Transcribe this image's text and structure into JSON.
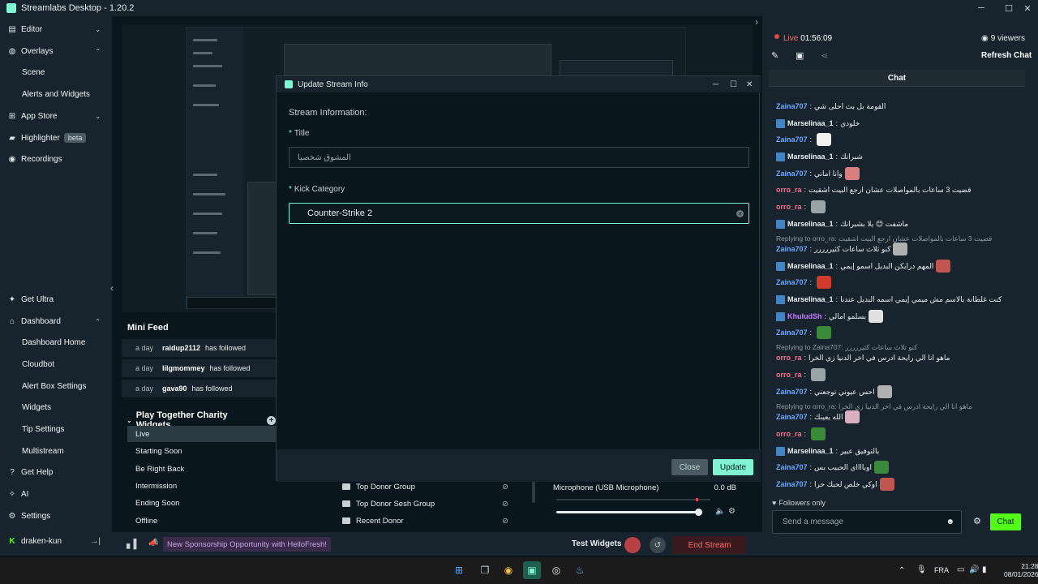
{
  "window": {
    "title": "Streamlabs Desktop - 1.20.2",
    "controls": {
      "minimize": "─",
      "maximize": "☐",
      "close": "✕"
    }
  },
  "sidebar": {
    "items": [
      {
        "label": "Editor"
      },
      {
        "label": "Overlays"
      },
      {
        "label": "Scene"
      },
      {
        "label": "Alerts and Widgets"
      },
      {
        "label": "App Store"
      },
      {
        "label": "Highlighter",
        "badge": "beta"
      },
      {
        "label": "Recordings"
      },
      {
        "label": "Get Ultra"
      },
      {
        "label": "Dashboard"
      },
      {
        "label": "Dashboard Home"
      },
      {
        "label": "Cloudbot"
      },
      {
        "label": "Alert Box Settings"
      },
      {
        "label": "Widgets"
      },
      {
        "label": "Tip Settings"
      },
      {
        "label": "Multistream"
      },
      {
        "label": "Get Help"
      },
      {
        "label": "AI"
      },
      {
        "label": "Settings"
      },
      {
        "label": "draken-kun"
      }
    ]
  },
  "minifeed": {
    "title": "Mini Feed",
    "rows": [
      {
        "ago": "a day",
        "user": "raidup2112",
        "action": "has followed"
      },
      {
        "ago": "a day",
        "user": "lilgmommey",
        "action": "has followed"
      },
      {
        "ago": "a day",
        "user": "gava90",
        "action": "has followed"
      }
    ]
  },
  "scenes": {
    "title": "Play Together Charity Widgets",
    "add": "+",
    "items": [
      "Live",
      "Starting Soon",
      "Be Right Back",
      "Intermission",
      "Ending Soon",
      "Offline"
    ]
  },
  "sources": [
    "Top Donor Group",
    "Top Donor Sesh Group",
    "Recent Donor"
  ],
  "mixer": {
    "device": "Microphone (USB Microphone)",
    "level": "0.0 dB",
    "volume_fraction": 0.97
  },
  "footer": {
    "sponsor": "New Sponsorship Opportunity with HelloFresh!",
    "test_widgets": "Test Widgets",
    "end_stream": "End Stream"
  },
  "dialog": {
    "title": "Update Stream Info",
    "section": "Stream Information:",
    "title_label": "Title",
    "title_value": "المشوق شخصيا",
    "category_label": "Kick Category",
    "category_value": "Counter-Strike 2",
    "close_button": "Close",
    "update_button": "Update"
  },
  "stream": {
    "live_label": "Live",
    "time": "01:56:09",
    "viewers": "9 viewers",
    "refresh_chat": "Refresh Chat",
    "chat_title": "Chat"
  },
  "chat": {
    "messages": [
      {
        "user": "Zaina707",
        "text": "القومة بل بث احلى شي"
      },
      {
        "user": "Marselinaa_1",
        "text": "خلودي"
      },
      {
        "user": "Zaina707",
        "text": ""
      },
      {
        "user": "Marselinaa_1",
        "text": "شبرانك"
      },
      {
        "user": "Zaina707",
        "text": "وانا اماني"
      },
      {
        "user": "orro_ra",
        "text": "قضيت 3 ساعات بالمواصلات عشان ارجع البيت اشقيت"
      },
      {
        "user": "orro_ra",
        "text": ""
      },
      {
        "user": "Marselinaa_1",
        "text": "ماشفت 😊 يلا بشبرانك"
      },
      {
        "user": "Zaina707",
        "text": "كنو ثلاث ساعات كثيررررر"
      },
      {
        "user": "Marselinaa_1",
        "text": "المهم درايكن البديل اسمو إيمي"
      },
      {
        "user": "Zaina707",
        "text": ""
      },
      {
        "user": "Marselinaa_1",
        "text": "كنت غلطانة بالاسم مش ميمي إيمي اسمه البديل عندنا"
      },
      {
        "user": "KhuludSh",
        "text": "بسلمو امالي"
      },
      {
        "user": "Zaina707",
        "text": ""
      },
      {
        "user": "orro_ra",
        "text": "ماهو انا الي رايحة ادرس في اخر الدنيا زي الخرا"
      },
      {
        "user": "orro_ra",
        "text": ""
      },
      {
        "user": "Zaina707",
        "text": "احس عيوني توجعني"
      },
      {
        "user": "Zaina707",
        "text": "الله يعينك"
      },
      {
        "user": "orro_ra",
        "text": ""
      },
      {
        "user": "Marselinaa_1",
        "text": "بالتوفيق عبير"
      },
      {
        "user": "Zaina707",
        "text": "اوبااااي الحبيب بس"
      },
      {
        "user": "Zaina707",
        "text": "اوكي خلص لحبك خرا"
      }
    ],
    "replies": [
      "Replying to orro_ra: قضيت 3 ساعات بالمواصلات عشان ارجع البيت اشقيت",
      "Replying to Zaina707: كنو ثلاث ساعات كثيررررر",
      "Replying to orro_ra: ماهو انا الي رايحة ادرس في اخر الدنيا زي الخرا"
    ],
    "followers_only": "Followers only",
    "input_placeholder": "Send a message",
    "send": "Chat"
  },
  "taskbar": {
    "lang": "FRA",
    "time": "21:28",
    "date": "08/01/2026"
  }
}
